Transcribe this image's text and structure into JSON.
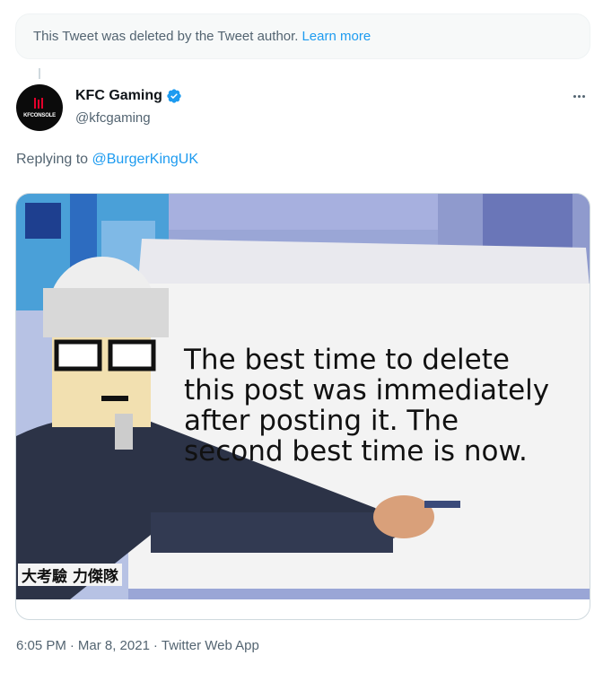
{
  "deleted_notice": {
    "text": "This Tweet was deleted by the Tweet author.",
    "link": "Learn more"
  },
  "author": {
    "display_name": "KFC Gaming",
    "handle": "@kfcgaming",
    "avatar_text": "KFCONSOLE",
    "verified": true
  },
  "reply": {
    "prefix": "Replying to",
    "mention": "@BurgerKingUK"
  },
  "media": {
    "caption": "The best time to delete this post was immediately after posting it. The second best time is now.",
    "sign_text": "大考驗 力傑隊"
  },
  "meta": {
    "time": "6:05 PM",
    "date": "Mar 8, 2021",
    "source": "Twitter Web App",
    "separator": "·"
  },
  "colors": {
    "accent": "#1d9bf0",
    "muted": "#536471",
    "brand_red": "#e4002b"
  },
  "icons": [
    "verified-badge-icon",
    "more-options-icon"
  ]
}
